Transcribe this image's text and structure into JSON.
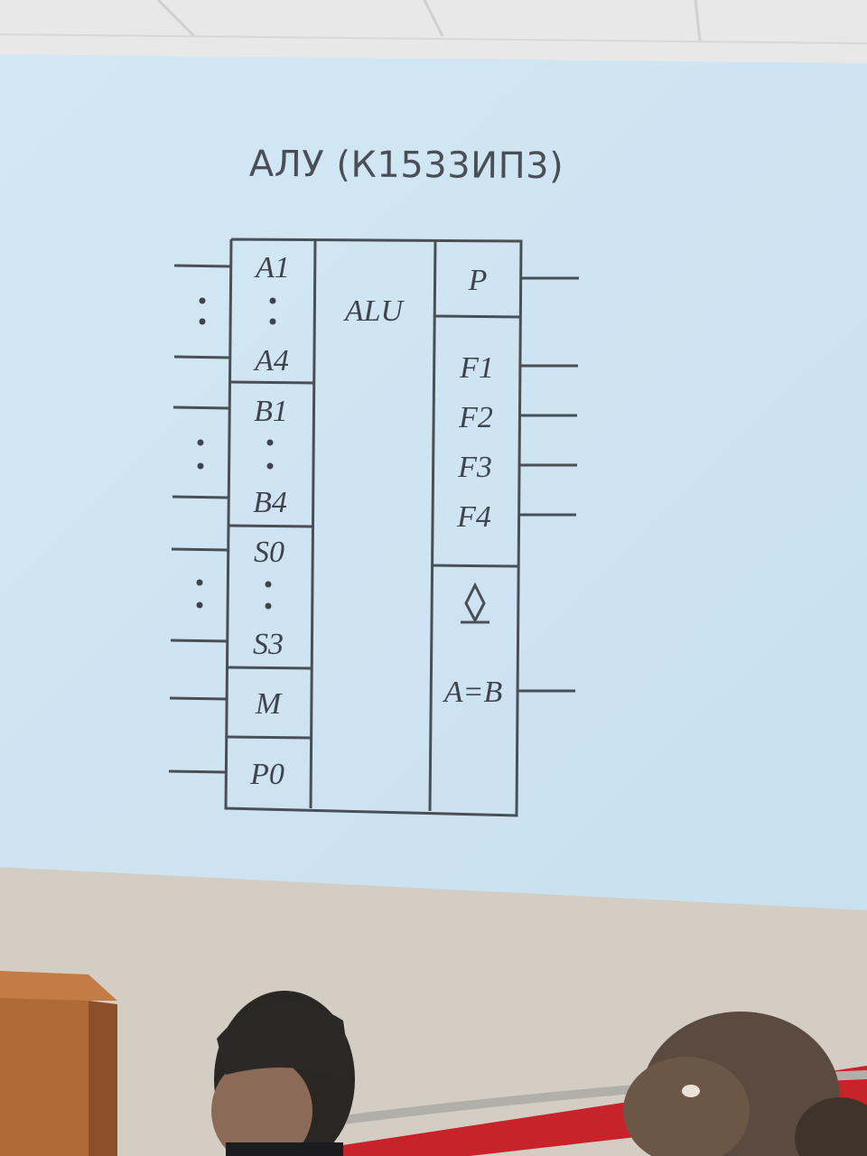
{
  "slide": {
    "title": "АЛУ (К1533ИП3)"
  },
  "chip": {
    "function_label": "ALU",
    "inputs": {
      "a_first": "A1",
      "a_last": "A4",
      "b_first": "B1",
      "b_last": "B4",
      "s_first": "S0",
      "s_last": "S3",
      "mode": "M",
      "carry_in": "P0"
    },
    "outputs": {
      "carry_out": "P",
      "f1": "F1",
      "f2": "F2",
      "f3": "F3",
      "f4": "F4",
      "compare": "A=B"
    }
  },
  "colors": {
    "screen": "#cfe4f2",
    "ink": "#3f444c",
    "wall": "#d2ccc4",
    "ceiling": "#e9e9ea",
    "accent_red": "#c8232a"
  },
  "icons": [
    "open-collector-diamond-icon",
    "ellipsis-dots-icon"
  ]
}
